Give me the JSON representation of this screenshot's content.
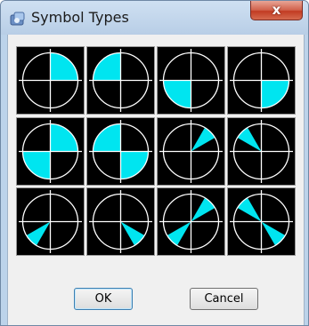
{
  "window": {
    "title": "Symbol Types",
    "close_label": "x"
  },
  "symbols": [
    {
      "type": "quarter-NE"
    },
    {
      "type": "quarter-NW"
    },
    {
      "type": "quarter-SW"
    },
    {
      "type": "quarter-SE"
    },
    {
      "type": "half-NE-SW"
    },
    {
      "type": "half-NW-SE"
    },
    {
      "type": "wedge-NE"
    },
    {
      "type": "wedge-NW"
    },
    {
      "type": "wedge-SW"
    },
    {
      "type": "wedge-SE"
    },
    {
      "type": "double-wedge-NE-SW"
    },
    {
      "type": "double-wedge-NW-SE"
    }
  ],
  "colors": {
    "fill": "#00e5f0",
    "line": "#ffffff",
    "background": "#000000"
  },
  "buttons": {
    "ok": "OK",
    "cancel": "Cancel"
  }
}
